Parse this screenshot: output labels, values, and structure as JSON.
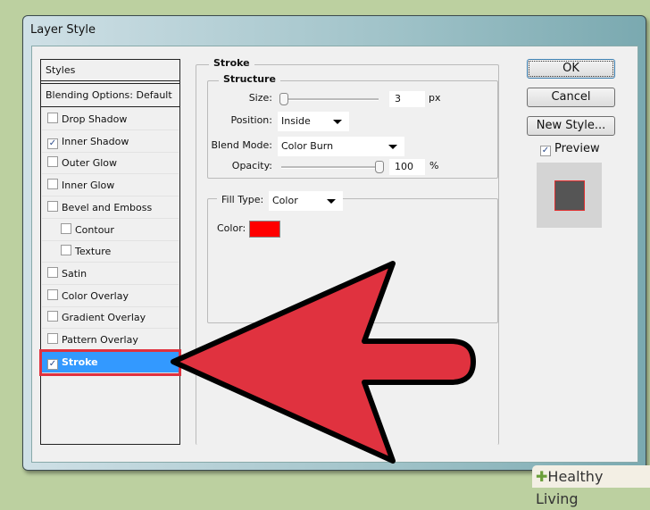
{
  "window": {
    "title": "Layer Style"
  },
  "styles_panel": {
    "header": "Styles",
    "blending": "Blending Options: Default",
    "items": [
      {
        "label": "Drop Shadow",
        "checked": false,
        "indent": false
      },
      {
        "label": "Inner Shadow",
        "checked": true,
        "indent": false
      },
      {
        "label": "Outer Glow",
        "checked": false,
        "indent": false
      },
      {
        "label": "Inner Glow",
        "checked": false,
        "indent": false
      },
      {
        "label": "Bevel and Emboss",
        "checked": false,
        "indent": false
      },
      {
        "label": "Contour",
        "checked": false,
        "indent": true
      },
      {
        "label": "Texture",
        "checked": false,
        "indent": true
      },
      {
        "label": "Satin",
        "checked": false,
        "indent": false
      },
      {
        "label": "Color Overlay",
        "checked": false,
        "indent": false
      },
      {
        "label": "Gradient Overlay",
        "checked": false,
        "indent": false
      },
      {
        "label": "Pattern Overlay",
        "checked": false,
        "indent": false
      },
      {
        "label": "Stroke",
        "checked": true,
        "indent": false,
        "selected": true
      }
    ]
  },
  "stroke": {
    "title": "Stroke",
    "structure": "Structure",
    "size_label": "Size:",
    "size_value": "3",
    "size_unit": "px",
    "position_label": "Position:",
    "position_value": "Inside",
    "blend_label": "Blend Mode:",
    "blend_value": "Color Burn",
    "opacity_label": "Opacity:",
    "opacity_value": "100",
    "opacity_unit": "%",
    "fill_type_label": "Fill Type:",
    "fill_type_value": "Color",
    "color_label": "Color:",
    "color": "#ff0000"
  },
  "buttons": {
    "ok": "OK",
    "cancel": "Cancel",
    "new_style": "New Style...",
    "preview": "Preview",
    "preview_checked": true
  },
  "annotation": {
    "arrow_color": "#e0323f"
  },
  "watermark": "Healthy Living"
}
